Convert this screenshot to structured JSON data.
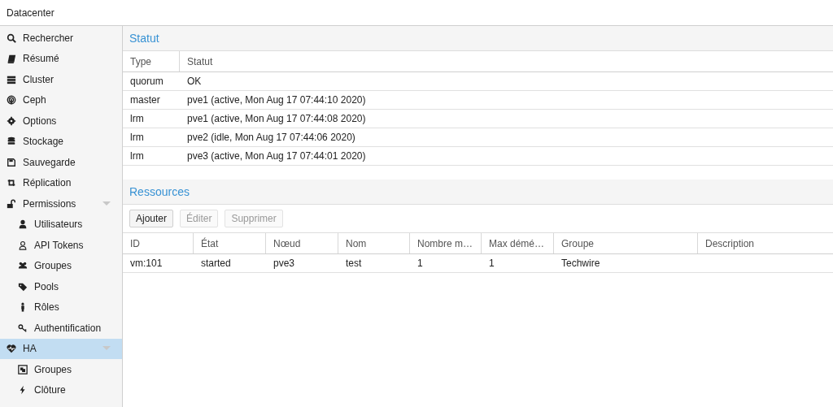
{
  "header": {
    "title": "Datacenter"
  },
  "sidebar": {
    "items": [
      {
        "label": "Rechercher",
        "selected": false
      },
      {
        "label": "Résumé",
        "selected": false
      },
      {
        "label": "Cluster",
        "selected": false
      },
      {
        "label": "Ceph",
        "selected": false
      },
      {
        "label": "Options",
        "selected": false
      },
      {
        "label": "Stockage",
        "selected": false
      },
      {
        "label": "Sauvegarde",
        "selected": false
      },
      {
        "label": "Réplication",
        "selected": false
      },
      {
        "label": "Permissions",
        "selected": false,
        "expanded": true,
        "children": [
          {
            "label": "Utilisateurs",
            "selected": false
          },
          {
            "label": "API Tokens",
            "selected": false
          },
          {
            "label": "Groupes",
            "selected": false
          },
          {
            "label": "Pools",
            "selected": false
          },
          {
            "label": "Rôles",
            "selected": false
          },
          {
            "label": "Authentification",
            "selected": false
          }
        ]
      },
      {
        "label": "HA",
        "selected": true,
        "expanded": true,
        "children": [
          {
            "label": "Groupes",
            "selected": false
          },
          {
            "label": "Clôture",
            "selected": false
          }
        ]
      }
    ]
  },
  "status_panel": {
    "title": "Statut",
    "columns": [
      "Type",
      "Statut"
    ],
    "rows": [
      [
        "quorum",
        "OK"
      ],
      [
        "master",
        "pve1 (active, Mon Aug 17 07:44:10 2020)"
      ],
      [
        "lrm",
        "pve1 (active, Mon Aug 17 07:44:08 2020)"
      ],
      [
        "lrm",
        "pve2 (idle, Mon Aug 17 07:44:06 2020)"
      ],
      [
        "lrm",
        "pve3 (active, Mon Aug 17 07:44:01 2020)"
      ]
    ]
  },
  "resources_panel": {
    "title": "Ressources",
    "buttons": [
      {
        "label": "Ajouter",
        "disabled": false
      },
      {
        "label": "Éditer",
        "disabled": true
      },
      {
        "label": "Supprimer",
        "disabled": true
      }
    ],
    "columns": [
      "ID",
      "État",
      "Nœud",
      "Nom",
      "Nombre m…",
      "Max démé…",
      "Groupe",
      "Description"
    ],
    "rows": [
      [
        "vm:101",
        "started",
        "pve3",
        "test",
        "1",
        "1",
        "Techwire",
        ""
      ]
    ]
  }
}
